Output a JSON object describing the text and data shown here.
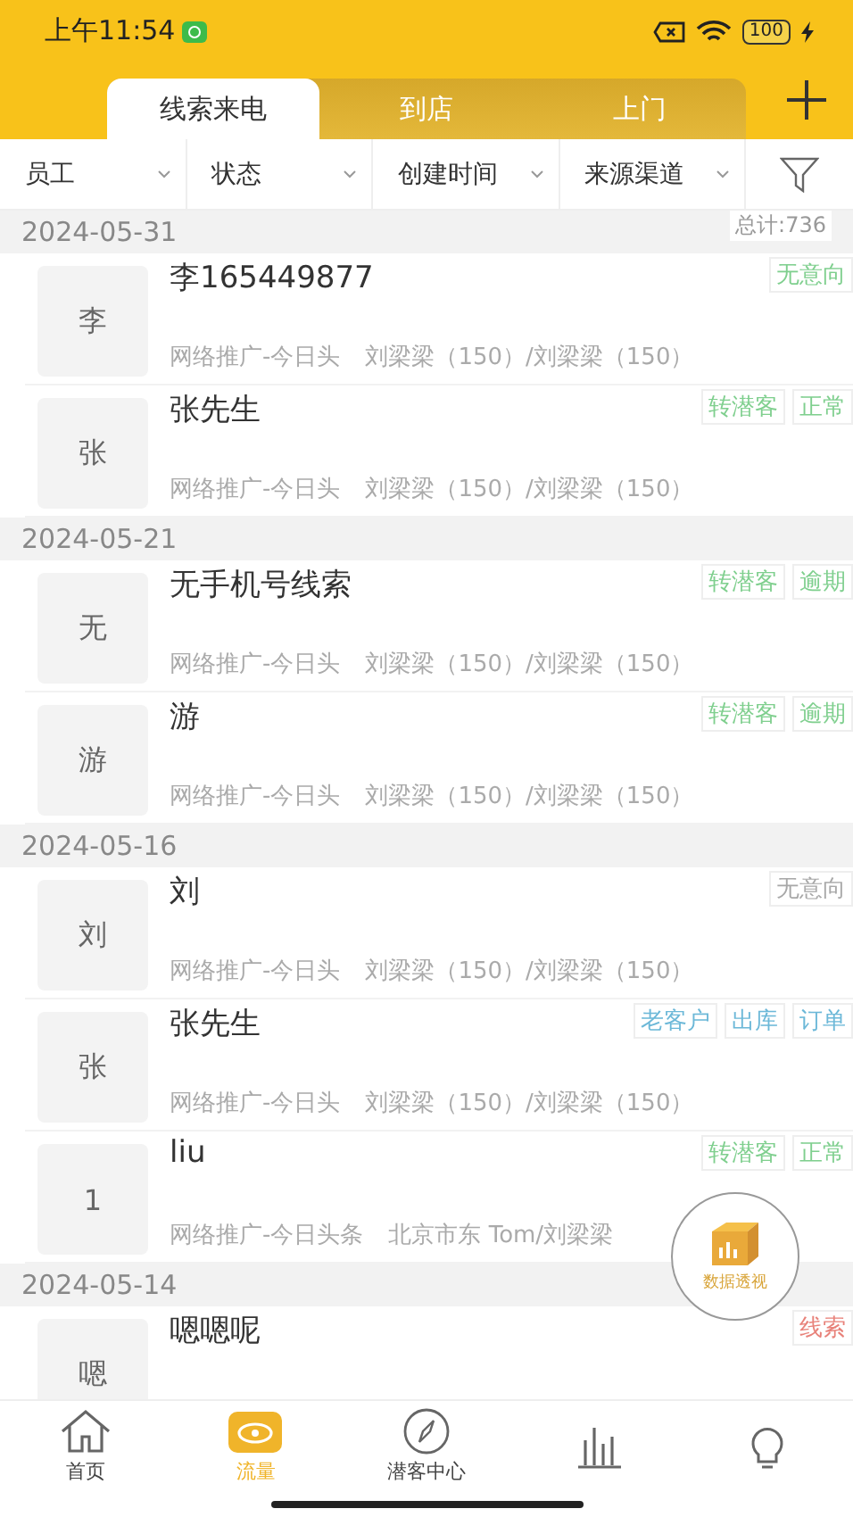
{
  "status_bar": {
    "time": "上午11:54",
    "battery": "100"
  },
  "tabs": [
    {
      "label": "线索来电",
      "selected": true
    },
    {
      "label": "到店",
      "selected": false
    },
    {
      "label": "上门",
      "selected": false
    }
  ],
  "filters": [
    "员工",
    "状态",
    "创建时间",
    "来源渠道"
  ],
  "total": "总计:736",
  "groups": [
    {
      "date": "2024-05-31",
      "rows": [
        {
          "avatar": "李",
          "name": "李165449877",
          "source": "网络推广-今日头",
          "owner": "刘梁梁（150）/刘梁梁（150）",
          "tags": [
            {
              "text": "无意向",
              "color": "#7fcf8e"
            }
          ]
        },
        {
          "avatar": "张",
          "name": "张先生",
          "source": "网络推广-今日头",
          "owner": "刘梁梁（150）/刘梁梁（150）",
          "tags": [
            {
              "text": "转潜客",
              "color": "#7fcf8e"
            },
            {
              "text": "正常",
              "color": "#7fcf8e"
            }
          ]
        }
      ]
    },
    {
      "date": "2024-05-21",
      "rows": [
        {
          "avatar": "无",
          "name": "无手机号线索",
          "source": "网络推广-今日头",
          "owner": "刘梁梁（150）/刘梁梁（150）",
          "tags": [
            {
              "text": "转潜客",
              "color": "#7fcf8e"
            },
            {
              "text": "逾期",
              "color": "#7fcf8e"
            }
          ]
        },
        {
          "avatar": "游",
          "name": "游",
          "source": "网络推广-今日头",
          "owner": "刘梁梁（150）/刘梁梁（150）",
          "tags": [
            {
              "text": "转潜客",
              "color": "#7fcf8e"
            },
            {
              "text": "逾期",
              "color": "#7fcf8e"
            }
          ]
        }
      ]
    },
    {
      "date": "2024-05-16",
      "rows": [
        {
          "avatar": "刘",
          "name": "刘",
          "source": "网络推广-今日头",
          "owner": "刘梁梁（150）/刘梁梁（150）",
          "tags": [
            {
              "text": "无意向",
              "color": "#a8a8a8"
            }
          ]
        },
        {
          "avatar": "张",
          "name": "张先生",
          "source": "网络推广-今日头",
          "owner": "刘梁梁（150）/刘梁梁（150）",
          "tags": [
            {
              "text": "老客户",
              "color": "#6cb8d8"
            },
            {
              "text": "出库",
              "color": "#6cb8d8"
            },
            {
              "text": "订单",
              "color": "#6cb8d8"
            }
          ]
        },
        {
          "avatar": "1",
          "name": "liu",
          "source": "网络推广-今日头条",
          "owner": "北京市东 Tom/刘梁梁",
          "tags": [
            {
              "text": "转潜客",
              "color": "#7fcf8e"
            },
            {
              "text": "正常",
              "color": "#7fcf8e"
            }
          ]
        }
      ]
    },
    {
      "date": "2024-05-14",
      "rows": [
        {
          "avatar": "嗯",
          "name": "嗯嗯呢",
          "tags": [
            {
              "text": "线索",
              "color": "#e8827a"
            }
          ]
        }
      ]
    }
  ],
  "fab": {
    "label": "数据透视"
  },
  "nav": [
    {
      "kind": "home",
      "label": "首页",
      "selected": false
    },
    {
      "kind": "traffic",
      "label": "流量",
      "selected": true
    },
    {
      "kind": "compass",
      "label": "潜客中心",
      "selected": false
    },
    {
      "kind": "chart",
      "selected": false
    },
    {
      "kind": "bulb",
      "selected": false
    }
  ]
}
